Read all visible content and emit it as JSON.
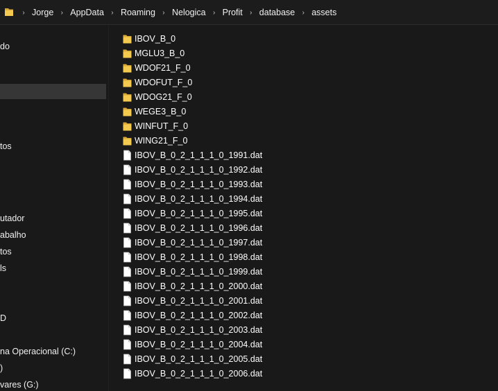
{
  "address_bar": {
    "icon": "folder-icon",
    "breadcrumbs": [
      "Jorge",
      "AppData",
      "Roaming",
      "Nelogica",
      "Profit",
      "database",
      "assets"
    ],
    "separator": "›"
  },
  "nav_pane": {
    "items": [
      {
        "label": "do",
        "top": 0
      },
      {
        "label": "tos",
        "top": 0
      },
      {
        "label": "utador",
        "top": 0
      },
      {
        "label": "abalho",
        "top": 0
      },
      {
        "label": "tos",
        "top": 0
      },
      {
        "label": "ls",
        "top": 0
      },
      {
        "label": "D",
        "top": 0
      },
      {
        "label": "na Operacional (C:)",
        "top": 0
      },
      {
        "label": ")",
        "top": 0
      },
      {
        "label": "vares (G:)",
        "top": 0
      }
    ]
  },
  "files": {
    "items": [
      {
        "name": "IBOV_B_0",
        "type": "folder"
      },
      {
        "name": "MGLU3_B_0",
        "type": "folder"
      },
      {
        "name": "WDOF21_F_0",
        "type": "folder"
      },
      {
        "name": "WDOFUT_F_0",
        "type": "folder"
      },
      {
        "name": "WDOG21_F_0",
        "type": "folder"
      },
      {
        "name": "WEGE3_B_0",
        "type": "folder"
      },
      {
        "name": "WINFUT_F_0",
        "type": "folder"
      },
      {
        "name": "WING21_F_0",
        "type": "folder"
      },
      {
        "name": "IBOV_B_0_2_1_1_1_0_1991.dat",
        "type": "file"
      },
      {
        "name": "IBOV_B_0_2_1_1_1_0_1992.dat",
        "type": "file"
      },
      {
        "name": "IBOV_B_0_2_1_1_1_0_1993.dat",
        "type": "file"
      },
      {
        "name": "IBOV_B_0_2_1_1_1_0_1994.dat",
        "type": "file"
      },
      {
        "name": "IBOV_B_0_2_1_1_1_0_1995.dat",
        "type": "file"
      },
      {
        "name": "IBOV_B_0_2_1_1_1_0_1996.dat",
        "type": "file"
      },
      {
        "name": "IBOV_B_0_2_1_1_1_0_1997.dat",
        "type": "file"
      },
      {
        "name": "IBOV_B_0_2_1_1_1_0_1998.dat",
        "type": "file"
      },
      {
        "name": "IBOV_B_0_2_1_1_1_0_1999.dat",
        "type": "file"
      },
      {
        "name": "IBOV_B_0_2_1_1_1_0_2000.dat",
        "type": "file"
      },
      {
        "name": "IBOV_B_0_2_1_1_1_0_2001.dat",
        "type": "file"
      },
      {
        "name": "IBOV_B_0_2_1_1_1_0_2002.dat",
        "type": "file"
      },
      {
        "name": "IBOV_B_0_2_1_1_1_0_2003.dat",
        "type": "file"
      },
      {
        "name": "IBOV_B_0_2_1_1_1_0_2004.dat",
        "type": "file"
      },
      {
        "name": "IBOV_B_0_2_1_1_1_0_2005.dat",
        "type": "file"
      },
      {
        "name": "IBOV_B_0_2_1_1_1_0_2006.dat",
        "type": "file"
      }
    ]
  },
  "colors": {
    "background": "#191919",
    "folder": "#f4c94f",
    "folder_dark": "#d9a83a",
    "selection": "#363636",
    "text": "#ffffff"
  }
}
